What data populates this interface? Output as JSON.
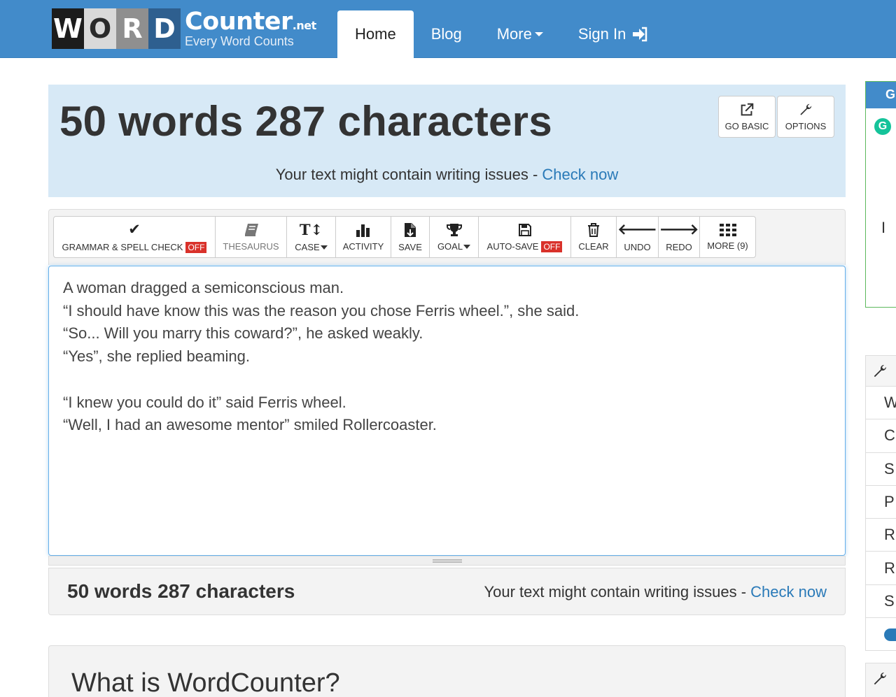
{
  "logo": {
    "letters": [
      "W",
      "O",
      "R",
      "D"
    ],
    "main": "Counter",
    "tld": ".net",
    "tagline": "Every Word Counts"
  },
  "nav": {
    "home": "Home",
    "blog": "Blog",
    "more": "More",
    "signin": "Sign In"
  },
  "counter": {
    "title": "50 words 287 characters",
    "issues_text": "Your text might contain writing issues - ",
    "check_link": "Check now"
  },
  "top_buttons": {
    "go_basic": "GO BASIC",
    "options": "OPTIONS"
  },
  "toolbar": {
    "grammar": "GRAMMAR & SPELL CHECK",
    "grammar_state": "OFF",
    "thesaurus": "THESAURUS",
    "case": "CASE",
    "activity": "ACTIVITY",
    "save": "SAVE",
    "goal": "GOAL",
    "autosave": "AUTO-SAVE",
    "autosave_state": "OFF",
    "clear": "CLEAR",
    "undo": "UNDO",
    "redo": "REDO",
    "more": "MORE (9)"
  },
  "editor": {
    "text": "A woman dragged a semiconscious man.\n“I should have know this was the reason you chose Ferris wheel.”, she said.\n“So... Will you marry this coward?”, he asked weakly.\n“Yes”, she replied beaming.\n\n“I knew you could do it” said Ferris wheel.\n“Well, I had an awesome mentor” smiled Rollercoaster."
  },
  "bottom": {
    "count": "50 words 287 characters",
    "issues_text": "Your text might contain writing issues - ",
    "check_link": "Check now"
  },
  "what_is": {
    "title": "What is WordCounter?"
  },
  "sidebar": {
    "top_head": "G",
    "top_icon": "G",
    "top_text": "I",
    "rows": [
      "W",
      "C",
      "S",
      "P",
      "R",
      "R",
      "S"
    ]
  },
  "colors": {
    "navbar": "#428bca",
    "counter_panel": "#d7e9f6",
    "link": "#2a7ab8",
    "off_badge": "#d9312a"
  }
}
